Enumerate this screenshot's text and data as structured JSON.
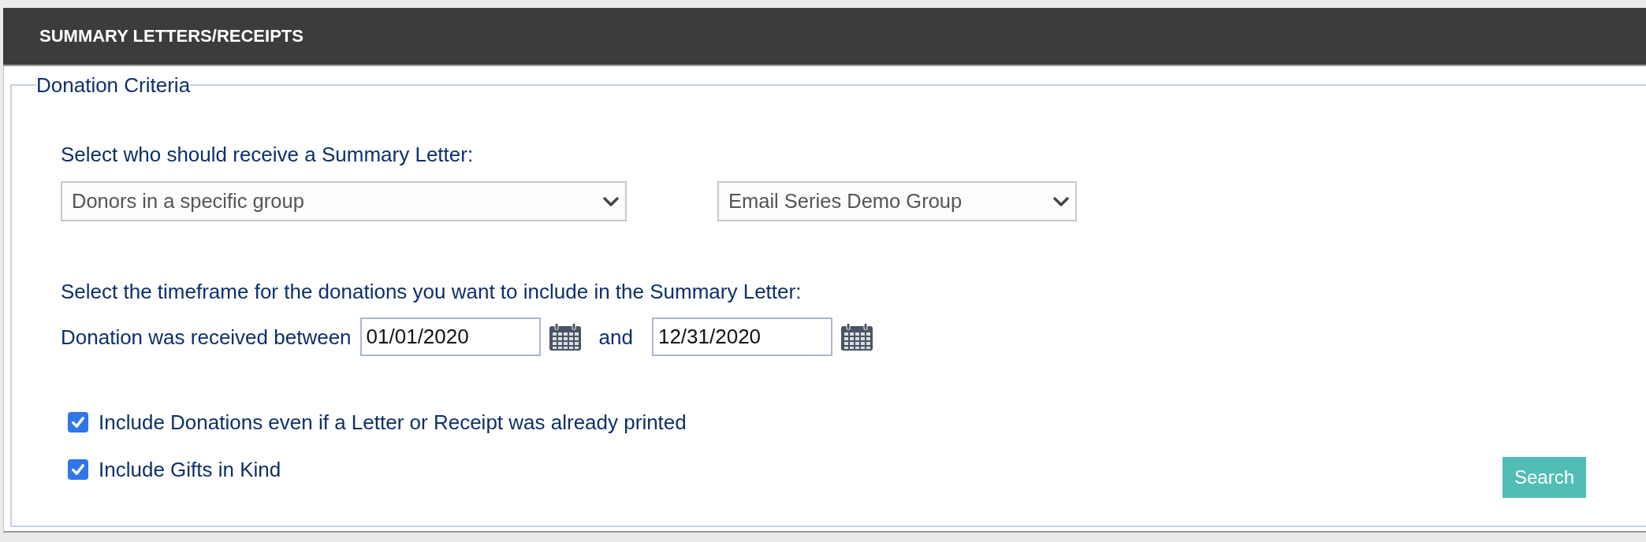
{
  "header": {
    "title": "SUMMARY LETTERS/RECEIPTS"
  },
  "criteria": {
    "legend": "Donation Criteria",
    "recipient": {
      "label": "Select who should receive a Summary Letter:",
      "selects": [
        {
          "value": "Donors in a specific group"
        },
        {
          "value": "Email Series Demo Group"
        }
      ]
    },
    "timeframe": {
      "label": "Select the timeframe for the donations you want to include in the Summary Letter:",
      "range_label": "Donation was received between",
      "from": "01/01/2020",
      "joiner": "and",
      "to": "12/31/2020"
    },
    "options": [
      {
        "label": "Include Donations even if a Letter or Receipt was already printed",
        "checked": true
      },
      {
        "label": "Include Gifts in Kind",
        "checked": true
      }
    ],
    "search_button": "Search"
  }
}
